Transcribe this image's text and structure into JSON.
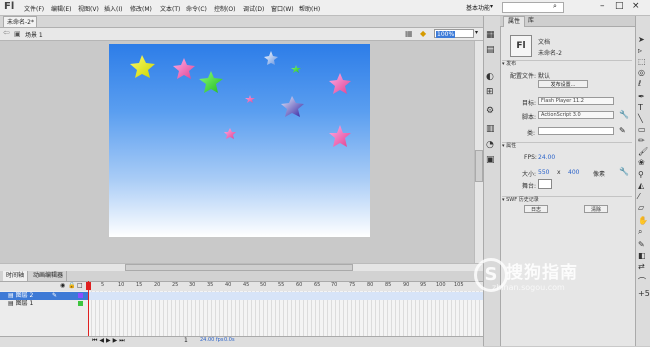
{
  "app": {
    "logo": "Fl"
  },
  "menu": [
    "文件(F)",
    "编辑(E)",
    "视图(V)",
    "插入(I)",
    "修改(M)",
    "文本(T)",
    "命令(C)",
    "控制(O)",
    "调试(D)",
    "窗口(W)",
    "帮助(H)"
  ],
  "titlebar": {
    "workspace": "基本功能",
    "win_min": "–",
    "win_max": "□",
    "win_close": "×"
  },
  "document": {
    "tab_name": "未命名-2*",
    "scene": "场景 1",
    "zoom": "100%"
  },
  "timeline": {
    "tabs": [
      "时间轴",
      "动画编辑器"
    ],
    "frame_numbers": [
      "5",
      "10",
      "15",
      "20",
      "25",
      "30",
      "35",
      "40",
      "45",
      "50",
      "55",
      "60",
      "65",
      "70",
      "75",
      "80",
      "85",
      "90",
      "95",
      "100",
      "105"
    ],
    "layers": [
      {
        "name": "图层 2"
      },
      {
        "name": "图层 1"
      }
    ],
    "status": {
      "frame": "1",
      "fps": "24.00 fps",
      "time": "0.0s"
    }
  },
  "panel": {
    "tabs": [
      "属性",
      "库"
    ],
    "doc_type": "文档",
    "doc_name": "未命名-2",
    "publish_header": "发布",
    "profile_label": "配置文件:",
    "profile_value": "默认",
    "publish_settings": "发布设置...",
    "target_label": "目标:",
    "target_value": "Flash Player 11.2",
    "script_label": "脚本:",
    "script_value": "ActionScript 3.0",
    "class_label": "类:",
    "props_header": "属性",
    "fps_label": "FPS:",
    "fps_value": "24.00",
    "size_label": "大小:",
    "width_value": "550",
    "x_label": "x",
    "height_value": "400",
    "unit_label": "像素",
    "stage_label": "舞台:",
    "swf_header": "SWF 历史记录",
    "log_button": "日志",
    "clear_button": "清除"
  },
  "watermark": {
    "brand": "搜狗指南",
    "url": "zhinan.sogou.com"
  },
  "colors": {
    "stage_top": "#2d7de8",
    "stage_bottom": "#ffffff",
    "selection": "#3e7ad6",
    "playhead": "#e02020"
  }
}
